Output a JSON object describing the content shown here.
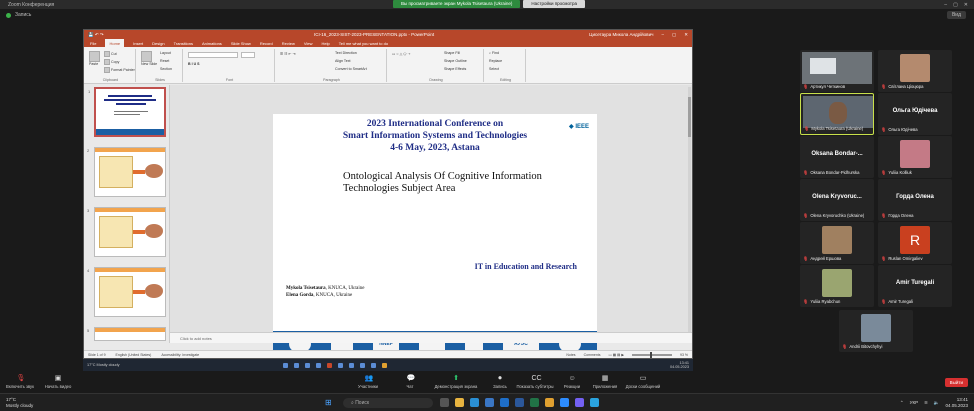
{
  "zoom": {
    "window_title": "Zoom Конференция",
    "share_banner": "Вы просматриваете экран Mykola Tsisetaura (Ukraine)",
    "view_options": "Настройки просмотра",
    "sub_title": "Запись",
    "view_button": "Вид"
  },
  "ppt": {
    "title": "ICI-16_2023-SIST-2023-PRESENTATION.pptx - PowerPoint",
    "user": "Цисетаура Микола Андрійович",
    "tabs": [
      "File",
      "Home",
      "Insert",
      "Design",
      "Transitions",
      "Animations",
      "Slide Show",
      "Record",
      "Review",
      "View",
      "Help",
      "Tell me what you want to do"
    ],
    "ribbon": {
      "paste": "Paste",
      "cut": "Cut",
      "copy": "Copy",
      "format_painter": "Format Painter",
      "clipboard": "Clipboard",
      "new_slide": "New Slide",
      "layout": "Layout",
      "reset": "Reset",
      "section": "Section",
      "slides": "Slides",
      "font": "Font",
      "paragraph": "Paragraph",
      "text_direction": "Text Direction",
      "align_text": "Align Text",
      "convert_smartart": "Convert to SmartArt",
      "drawing": "Drawing",
      "shape_fill": "Shape Fill",
      "shape_outline": "Shape Outline",
      "shape_effects": "Shape Effects",
      "find": "Find",
      "replace": "Replace",
      "select": "Select",
      "editing": "Editing"
    },
    "notes_placeholder": "Click to add notes",
    "status_left": "Slide 1 of 9",
    "status_lang": "English (United States)",
    "status_access": "Accessibility: Investigate",
    "status_notes": "Notes",
    "status_comments": "Comments",
    "zoom_level": "93 %"
  },
  "slide": {
    "line1": "2023 International Conference on",
    "line2": "Smart Information Systems and Technologies",
    "line3": "4-6 May, 2023, Astana",
    "ieee": "IEEE",
    "topic_line1": "Ontological Analysis Of Cognitive Information",
    "topic_line2": "Technologies Subject Area",
    "track": "IT in Education and Research",
    "author1_name": "Mykola Tsisetaura",
    "author1_affil": ", KNUCA, Ukraine",
    "author2_name": "Elena Gorda",
    "author2_affil": ", KNUCA, Ukraine",
    "logos": [
      "",
      "",
      "NNEF",
      "",
      "",
      "АУЭС",
      ""
    ]
  },
  "thumbnails": [
    1,
    2,
    3,
    4,
    5
  ],
  "inner_taskbar": {
    "weather_temp": "17°C",
    "weather_text": "Mostly cloudy",
    "time": "13:41",
    "date": "04.05.2023"
  },
  "participants": [
    {
      "name": "Артикул Четкинов",
      "type": "video"
    },
    {
      "name": "Світлана Ціоцюра",
      "type": "face"
    },
    {
      "name": "Mykola Tsisetaura (Ukraine)",
      "type": "face",
      "active": true
    },
    {
      "name": "Ольга Юдічева",
      "center": "Ольга Юдічева",
      "type": "name"
    },
    {
      "name": "Oksana Bondar-Pidhurska",
      "center": "Oksana Bondar-...",
      "type": "name"
    },
    {
      "name": "Yuliia Kolliuk",
      "type": "face"
    },
    {
      "name": "Olena Kryvoruchko (Ukraine)",
      "center": "Olena Kryvoruc...",
      "type": "name"
    },
    {
      "name": "Горда Олена",
      "center": "Горда Олена",
      "type": "name"
    },
    {
      "name": "Андрей Ершова",
      "type": "face"
    },
    {
      "name": "Ruslan Omirgaliev",
      "type": "letter",
      "letter": "R"
    },
    {
      "name": "Yuliia Ryabchun",
      "type": "face"
    },
    {
      "name": "Amir Turegali",
      "center": "Amir Turegali",
      "type": "name"
    },
    {
      "name": "Andrii Bitovchyhyi",
      "type": "face"
    }
  ],
  "toolbar": {
    "mic": "Включить звук",
    "video": "Начать видео",
    "participants": "Участники",
    "participants_count": "22",
    "chat": "Чат",
    "share": "Демонстрация экрана",
    "record": "Запись",
    "subtitles": "Показать субтитры",
    "reactions": "Реакции",
    "apps": "Приложения",
    "whiteboard": "Доски сообщений",
    "exit": "Выйти"
  },
  "win": {
    "temp": "17°C",
    "weather": "Mostly cloudy",
    "search": "Поиск",
    "lang": "УКР",
    "time": "13:41",
    "date": "04.05.2023"
  }
}
